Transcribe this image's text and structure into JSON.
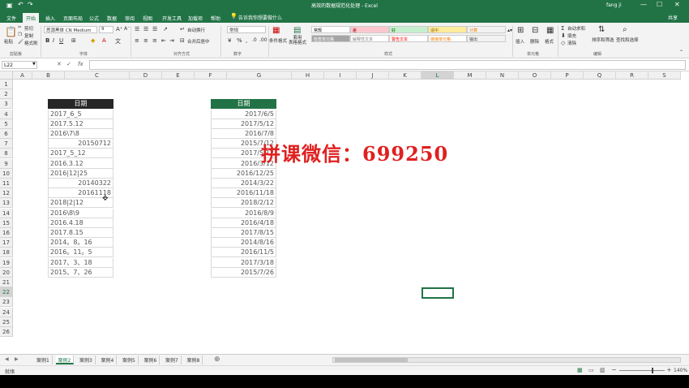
{
  "window": {
    "title": "高效的数据规范化处理 - Excel",
    "user": "fang ji",
    "share": "共享",
    "tell_me": "告诉我你想要做什么"
  },
  "ribbon_tabs": [
    "文件",
    "开始",
    "插入",
    "页面布局",
    "公式",
    "数据",
    "审阅",
    "视图",
    "开发工具",
    "加载项",
    "帮助"
  ],
  "active_tab": "开始",
  "ribbon": {
    "paste": "粘贴",
    "cut": "剪切",
    "copy": "复制",
    "format_painter": "格式刷",
    "clipboard": "剪贴板",
    "font_name": "思源黑体 CN Medium",
    "font_size": "9",
    "font_group": "字体",
    "wrap_text": "自动换行",
    "merge_center": "合并后居中",
    "alignment_group": "对齐方式",
    "number_format": "常规",
    "number_group": "数字",
    "conditional_format": "条件格式",
    "format_as_table": "套用\n表格格式",
    "styles_group": "样式",
    "insert": "插入",
    "delete": "删除",
    "format": "格式",
    "cells_group": "单元格",
    "autosum": "自动求和",
    "fill": "填充",
    "clear": "清除",
    "sort_filter": "排序和筛选",
    "find_select": "查找和选择",
    "editing_group": "编辑",
    "styles": [
      {
        "label": "常规",
        "bg": "#ffffff",
        "fg": "#000000"
      },
      {
        "label": "差",
        "bg": "#ffc7ce",
        "fg": "#9c0006"
      },
      {
        "label": "好",
        "bg": "#c6efce",
        "fg": "#006100"
      },
      {
        "label": "适中",
        "bg": "#ffeb9c",
        "fg": "#9c6500"
      },
      {
        "label": "计算",
        "bg": "#f2f2f2",
        "fg": "#fa7d00"
      },
      {
        "label": "检查单元格",
        "bg": "#a5a5a5",
        "fg": "#ffffff"
      },
      {
        "label": "解释性文本",
        "bg": "#ffffff",
        "fg": "#7f7f7f"
      },
      {
        "label": "警告文本",
        "bg": "#ffffff",
        "fg": "#ff0000"
      },
      {
        "label": "链接单元格",
        "bg": "#ffffff",
        "fg": "#fa7d00"
      },
      {
        "label": "输出",
        "bg": "#f2f2f2",
        "fg": "#3f3f3f"
      }
    ]
  },
  "formula_bar": {
    "name_box": "L22",
    "fx": "fx",
    "value": ""
  },
  "columns": [
    "A",
    "B",
    "C",
    "D",
    "E",
    "F",
    "G",
    "H",
    "I",
    "J",
    "K",
    "L",
    "M",
    "N",
    "O",
    "P",
    "Q",
    "R",
    "S"
  ],
  "rows": [
    "1",
    "2",
    "3",
    "4",
    "5",
    "6",
    "7",
    "8",
    "9",
    "10",
    "11",
    "12",
    "13",
    "14",
    "15",
    "16",
    "17",
    "18",
    "19",
    "20",
    "21",
    "22",
    "23",
    "24",
    "25",
    "26"
  ],
  "selected_cell": {
    "column": "L",
    "row": "22"
  },
  "left_table": {
    "header": "日期",
    "header_bg": "#262626",
    "values": [
      "2017_6_5",
      "2017.5.12",
      "2016\\7\\8",
      "20150712",
      "2017_5_12",
      "2016.3.12",
      "2016|12|25",
      "20140322",
      "20161118",
      "2018|2|12",
      "2016\\8\\9",
      "2016.4.18",
      "2017.8.15",
      "2014。8。16",
      "2016。11。5",
      "2017、3、18",
      "2015、7、26"
    ],
    "right_aligned": [
      false,
      false,
      false,
      true,
      false,
      false,
      false,
      true,
      true,
      false,
      false,
      false,
      false,
      false,
      false,
      false,
      false
    ]
  },
  "right_table": {
    "header": "日期",
    "header_bg": "#217346",
    "values": [
      "2017/6/5",
      "2017/5/12",
      "2016/7/8",
      "2015/7/12",
      "2017/5/12",
      "2016/3/12",
      "2016/12/25",
      "2014/3/22",
      "2016/11/18",
      "2018/2/12",
      "2016/8/9",
      "2016/4/18",
      "2017/8/15",
      "2014/8/16",
      "2016/11/5",
      "2017/3/18",
      "2015/7/26"
    ]
  },
  "watermark": "拼课微信：699250",
  "sheet_tabs": [
    "案例1",
    "案例2",
    "案例3",
    "案例4",
    "案例5",
    "案例6",
    "案例7",
    "案例8"
  ],
  "active_sheet": "案例2",
  "status": {
    "mode": "就绪",
    "zoom": "140%"
  },
  "colors": {
    "excel_green": "#217346",
    "watermark_red": "#e02020"
  }
}
